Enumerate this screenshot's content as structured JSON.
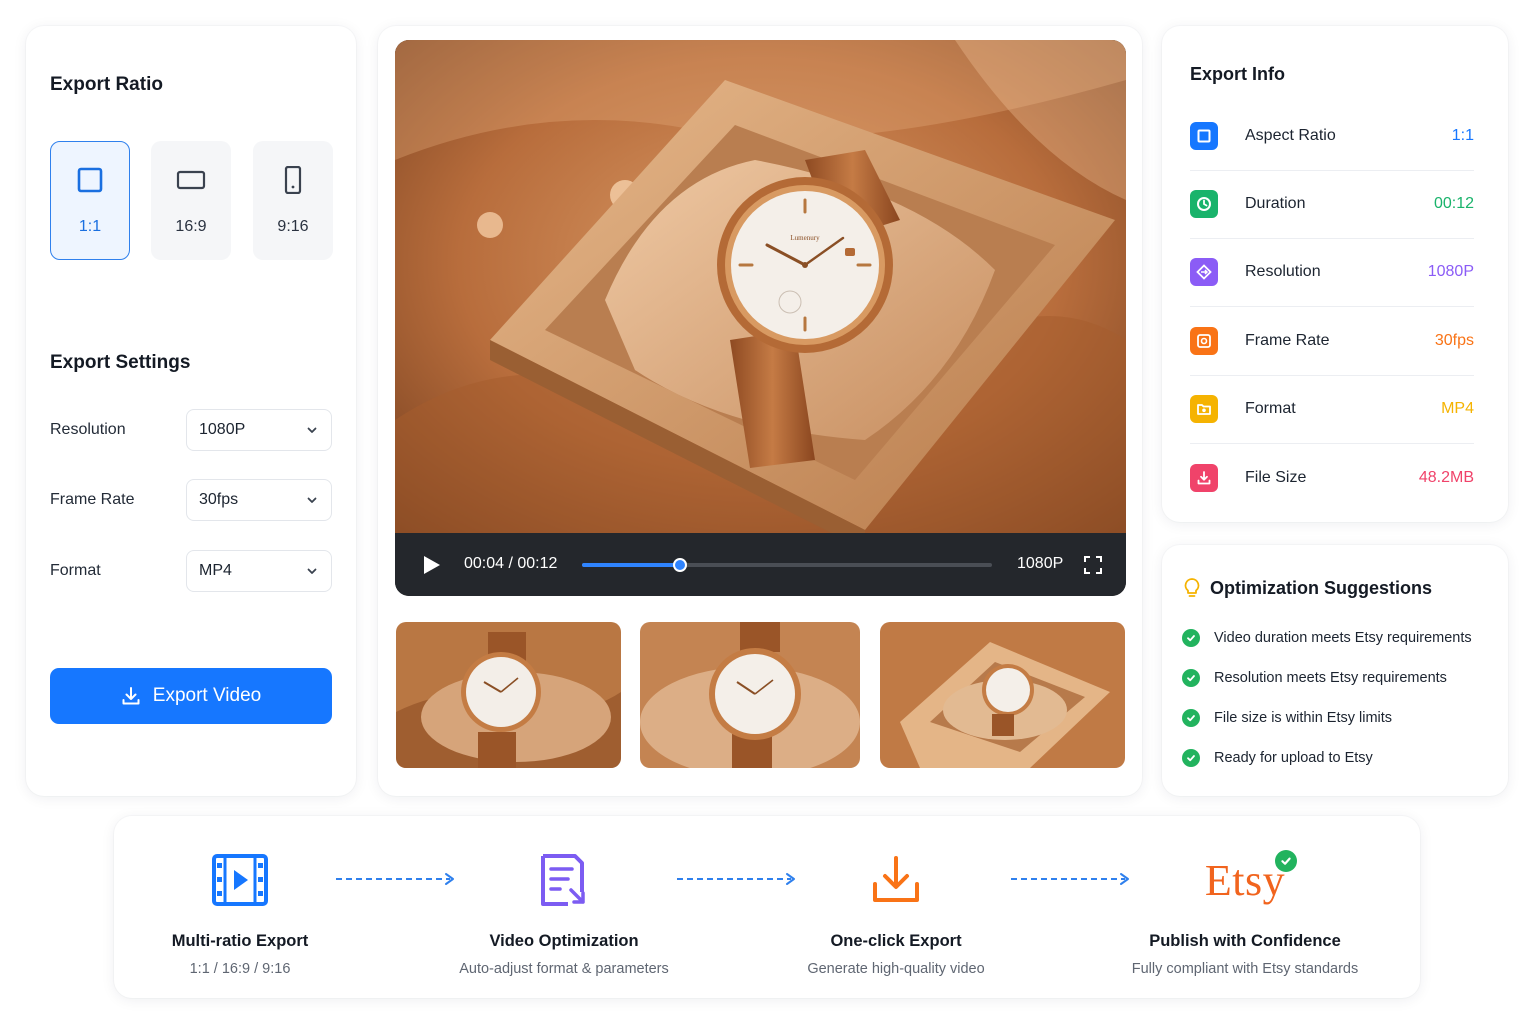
{
  "export_ratio": {
    "title": "Export Ratio",
    "options": [
      {
        "label": "1:1",
        "selected": true
      },
      {
        "label": "16:9",
        "selected": false
      },
      {
        "label": "9:16",
        "selected": false
      }
    ]
  },
  "export_settings": {
    "title": "Export Settings",
    "rows": [
      {
        "label": "Resolution",
        "value": "1080P"
      },
      {
        "label": "Frame Rate",
        "value": "30fps"
      },
      {
        "label": "Format",
        "value": "MP4"
      }
    ],
    "export_button": "Export Video"
  },
  "player": {
    "time": "00:04 / 00:12",
    "progress": 0.24,
    "quality": "1080P",
    "watch_brand": "Lumenury"
  },
  "export_info": {
    "title": "Export Info",
    "rows": [
      {
        "label": "Aspect Ratio",
        "value": "1:1",
        "color": "#1677ff",
        "icon": "aspect-icon"
      },
      {
        "label": "Duration",
        "value": "00:12",
        "color": "#19b36b",
        "icon": "clock-icon"
      },
      {
        "label": "Resolution",
        "value": "1080P",
        "color": "#8b5cf6",
        "icon": "resolution-icon"
      },
      {
        "label": "Frame Rate",
        "value": "30fps",
        "color": "#f97316",
        "icon": "frame-rate-icon"
      },
      {
        "label": "Format",
        "value": "MP4",
        "color": "#f5b301",
        "icon": "format-icon"
      },
      {
        "label": "File Size",
        "value": "48.2MB",
        "color": "#f0436a",
        "icon": "file-size-icon"
      }
    ]
  },
  "suggestions": {
    "title": "Optimization Suggestions",
    "items": [
      "Video duration meets Etsy requirements",
      "Resolution meets Etsy requirements",
      "File size is within Etsy limits",
      "Ready for upload to Etsy"
    ]
  },
  "workflow": {
    "steps": [
      {
        "title": "Multi-ratio Export",
        "subtitle": "1:1 / 16:9 / 9:16"
      },
      {
        "title": "Video Optimization",
        "subtitle": "Auto-adjust format & parameters"
      },
      {
        "title": "One-click Export",
        "subtitle": "Generate high-quality video"
      },
      {
        "title": "Publish with Confidence",
        "subtitle": "Fully compliant with Etsy standards"
      }
    ],
    "etsy_logo_text": "Etsy"
  },
  "colors": {
    "accent": "#1677ff",
    "success": "#22b35e",
    "etsy_orange": "#f1641e"
  }
}
